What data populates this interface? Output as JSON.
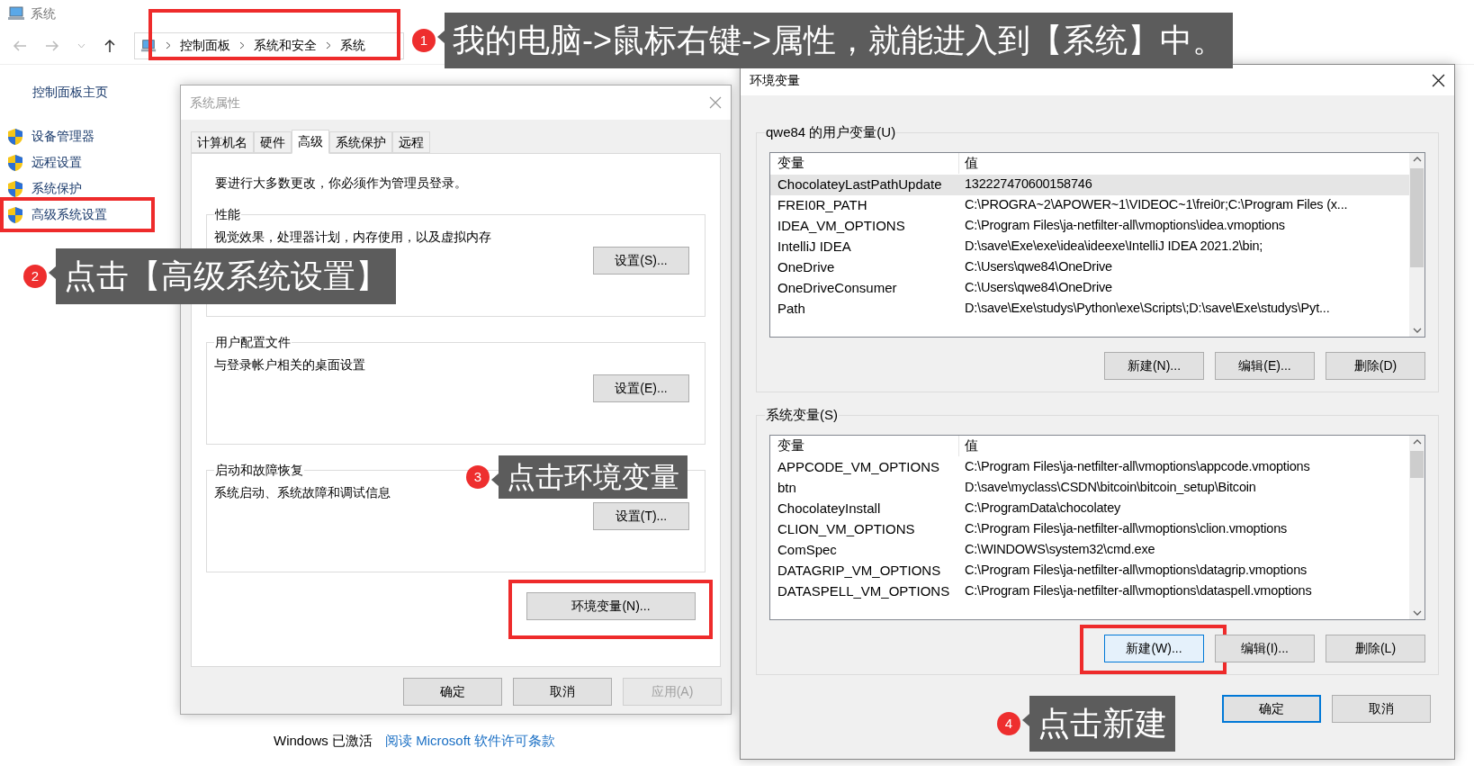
{
  "explorer": {
    "title": "系统",
    "breadcrumb": {
      "highlighted": true,
      "items": [
        "控制面板",
        "系统和安全",
        "系统"
      ]
    },
    "sidebar_home": "控制面板主页",
    "sidebar_items": [
      {
        "label": "设备管理器",
        "highlighted": false
      },
      {
        "label": "远程设置",
        "highlighted": false
      },
      {
        "label": "系统保护",
        "highlighted": false
      },
      {
        "label": "高级系统设置",
        "highlighted": true
      }
    ],
    "activation": {
      "status": "Windows 已激活",
      "link": "阅读 Microsoft 软件许可条款"
    }
  },
  "system_properties": {
    "title": "系统属性",
    "tabs": [
      {
        "label": "计算机名",
        "selected": false
      },
      {
        "label": "硬件",
        "selected": false
      },
      {
        "label": "高级",
        "selected": true
      },
      {
        "label": "系统保护",
        "selected": false
      },
      {
        "label": "远程",
        "selected": false
      }
    ],
    "notice": "要进行大多数更改，你必须作为管理员登录。",
    "groups": [
      {
        "title": "性能",
        "description": "视觉效果，处理器计划，内存使用，以及虚拟内存",
        "button": "设置(S)..."
      },
      {
        "title": "用户配置文件",
        "description": "与登录帐户相关的桌面设置",
        "button": "设置(E)..."
      },
      {
        "title": "启动和故障恢复",
        "description": "系统启动、系统故障和调试信息",
        "button": "设置(T)..."
      }
    ],
    "env_button": {
      "label": "环境变量(N)...",
      "highlighted": true
    },
    "buttons": [
      {
        "label": "确定",
        "disabled": false
      },
      {
        "label": "取消",
        "disabled": false
      },
      {
        "label": "应用(A)",
        "disabled": true
      }
    ]
  },
  "environment_variables": {
    "title": "环境变量",
    "sections": [
      {
        "title": "qwe84 的用户变量(U)",
        "columns": [
          "变量",
          "值"
        ],
        "rows": [
          {
            "name": "ChocolateyLastPathUpdate",
            "value": "132227470600158746",
            "selected": true
          },
          {
            "name": "FREI0R_PATH",
            "value": "C:\\PROGRA~2\\APOWER~1\\VIDEOC~1\\frei0r;C:\\Program Files (x...",
            "selected": false
          },
          {
            "name": "IDEA_VM_OPTIONS",
            "value": "C:\\Program Files\\ja-netfilter-all\\vmoptions\\idea.vmoptions",
            "selected": false
          },
          {
            "name": "IntelliJ IDEA",
            "value": "D:\\save\\Exe\\exe\\idea\\ideexe\\IntelliJ IDEA 2021.2\\bin;",
            "selected": false
          },
          {
            "name": "OneDrive",
            "value": "C:\\Users\\qwe84\\OneDrive",
            "selected": false
          },
          {
            "name": "OneDriveConsumer",
            "value": "C:\\Users\\qwe84\\OneDrive",
            "selected": false
          },
          {
            "name": "Path",
            "value": "D:\\save\\Exe\\studys\\Python\\exe\\Scripts\\;D:\\save\\Exe\\studys\\Pyt...",
            "selected": false
          }
        ],
        "buttons": [
          {
            "label": "新建(N)...",
            "highlighted": false,
            "focused": false
          },
          {
            "label": "编辑(E)...",
            "highlighted": false,
            "focused": false
          },
          {
            "label": "删除(D)",
            "highlighted": false,
            "focused": false
          }
        ]
      },
      {
        "title": "系统变量(S)",
        "columns": [
          "变量",
          "值"
        ],
        "rows": [
          {
            "name": "APPCODE_VM_OPTIONS",
            "value": "C:\\Program Files\\ja-netfilter-all\\vmoptions\\appcode.vmoptions",
            "selected": false
          },
          {
            "name": "btn",
            "value": "D:\\save\\myclass\\CSDN\\bitcoin\\bitcoin_setup\\Bitcoin",
            "selected": false
          },
          {
            "name": "ChocolateyInstall",
            "value": "C:\\ProgramData\\chocolatey",
            "selected": false
          },
          {
            "name": "CLION_VM_OPTIONS",
            "value": "C:\\Program Files\\ja-netfilter-all\\vmoptions\\clion.vmoptions",
            "selected": false
          },
          {
            "name": "ComSpec",
            "value": "C:\\WINDOWS\\system32\\cmd.exe",
            "selected": false
          },
          {
            "name": "DATAGRIP_VM_OPTIONS",
            "value": "C:\\Program Files\\ja-netfilter-all\\vmoptions\\datagrip.vmoptions",
            "selected": false
          },
          {
            "name": "DATASPELL_VM_OPTIONS",
            "value": "C:\\Program Files\\ja-netfilter-all\\vmoptions\\dataspell.vmoptions",
            "selected": false
          }
        ],
        "buttons": [
          {
            "label": "新建(W)...",
            "highlighted": true,
            "focused": true
          },
          {
            "label": "编辑(I)...",
            "highlighted": false,
            "focused": false
          },
          {
            "label": "删除(L)",
            "highlighted": false,
            "focused": false
          }
        ]
      }
    ],
    "buttons": [
      {
        "label": "确定",
        "default": true
      },
      {
        "label": "取消",
        "default": false
      }
    ]
  },
  "annotations": [
    {
      "number": "1",
      "text": "我的电脑->鼠标右键->属性，就能进入到【系统】中。"
    },
    {
      "number": "2",
      "text": "点击【高级系统设置】"
    },
    {
      "number": "3",
      "text": "点击环境变量"
    },
    {
      "number": "4",
      "text": "点击新建"
    }
  ]
}
